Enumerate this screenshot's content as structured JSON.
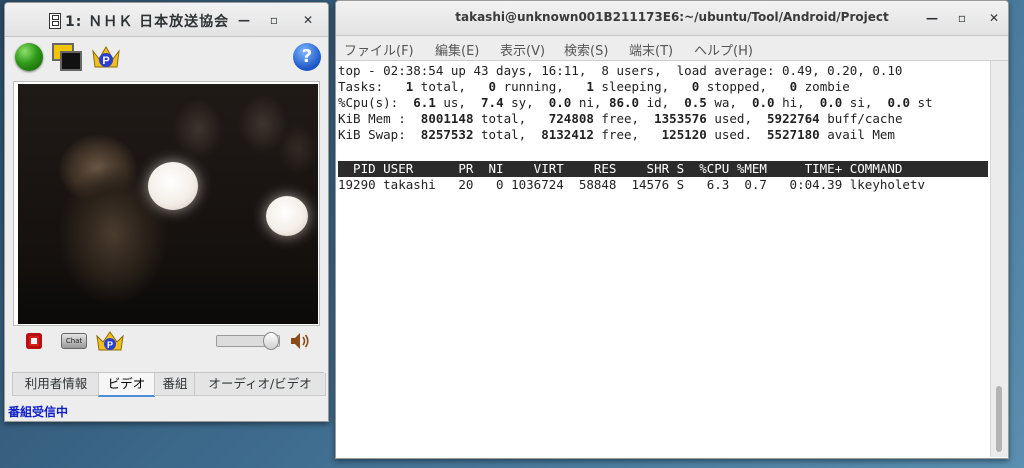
{
  "left_window": {
    "title": "1: ＮＨＫ 日本放送協会",
    "controls": {
      "minimize": "—",
      "maximize": "▫",
      "close": "✕"
    },
    "toolbar_icons": [
      "green-ball-icon",
      "screens-icon",
      "crown-p-icon",
      "help-icon"
    ],
    "help_glyph": "?",
    "chat_label": "Chat",
    "volume_fraction": 0.85,
    "tabs": [
      {
        "label": "利用者情報",
        "active": false
      },
      {
        "label": "ビデオ",
        "active": true
      },
      {
        "label": "番組",
        "active": false
      },
      {
        "label": "オーディオ/ビデオ",
        "active": false
      }
    ],
    "status_text": "番組受信中"
  },
  "right_window": {
    "title": "takashi@unknown001B211173E6:~/ubuntu/Tool/Android/Project",
    "controls": {
      "minimize": "—",
      "maximize": "▫",
      "close": "✕"
    },
    "menu": [
      "ファイル(F)",
      "編集(E)",
      "表示(V)",
      "検索(S)",
      "端末(T)",
      "ヘルプ(H)"
    ],
    "terminal": {
      "line1": "top - 02:38:54 up 43 days, 16:11,  8 users,  load average: 0.49, 0.20, 0.10",
      "tasks": {
        "label": "Tasks:",
        "total": "1",
        "running": "0",
        "sleeping": "1",
        "stopped": "0",
        "zombie": "0"
      },
      "cpu": {
        "label": "%Cpu(s):",
        "us": "6.1",
        "sy": "7.4",
        "ni": "0.0",
        "id": "86.0",
        "wa": "0.5",
        "hi": "0.0",
        "si": "0.0",
        "st": "0.0"
      },
      "mem": {
        "label": "KiB Mem :",
        "total": "8001148",
        "free": "724808",
        "used": "1353576",
        "buff_cache": "5922764"
      },
      "swap": {
        "label": "KiB Swap:",
        "total": "8257532",
        "free": "8132412",
        "used": "125120",
        "avail": "5527180"
      },
      "header": "  PID USER      PR  NI    VIRT    RES    SHR S  %CPU %MEM     TIME+ COMMAND",
      "processes": [
        "19290 takashi   20   0 1036724  58848  14576 S   6.3  0.7   0:04.39 lkeyholetv"
      ]
    }
  },
  "colors": {
    "status_text": "#1020c8",
    "tab_active_underline": "#4a90d9",
    "terminal_header_bg": "#2b2b2b",
    "stop_button": "#d91d1d"
  }
}
